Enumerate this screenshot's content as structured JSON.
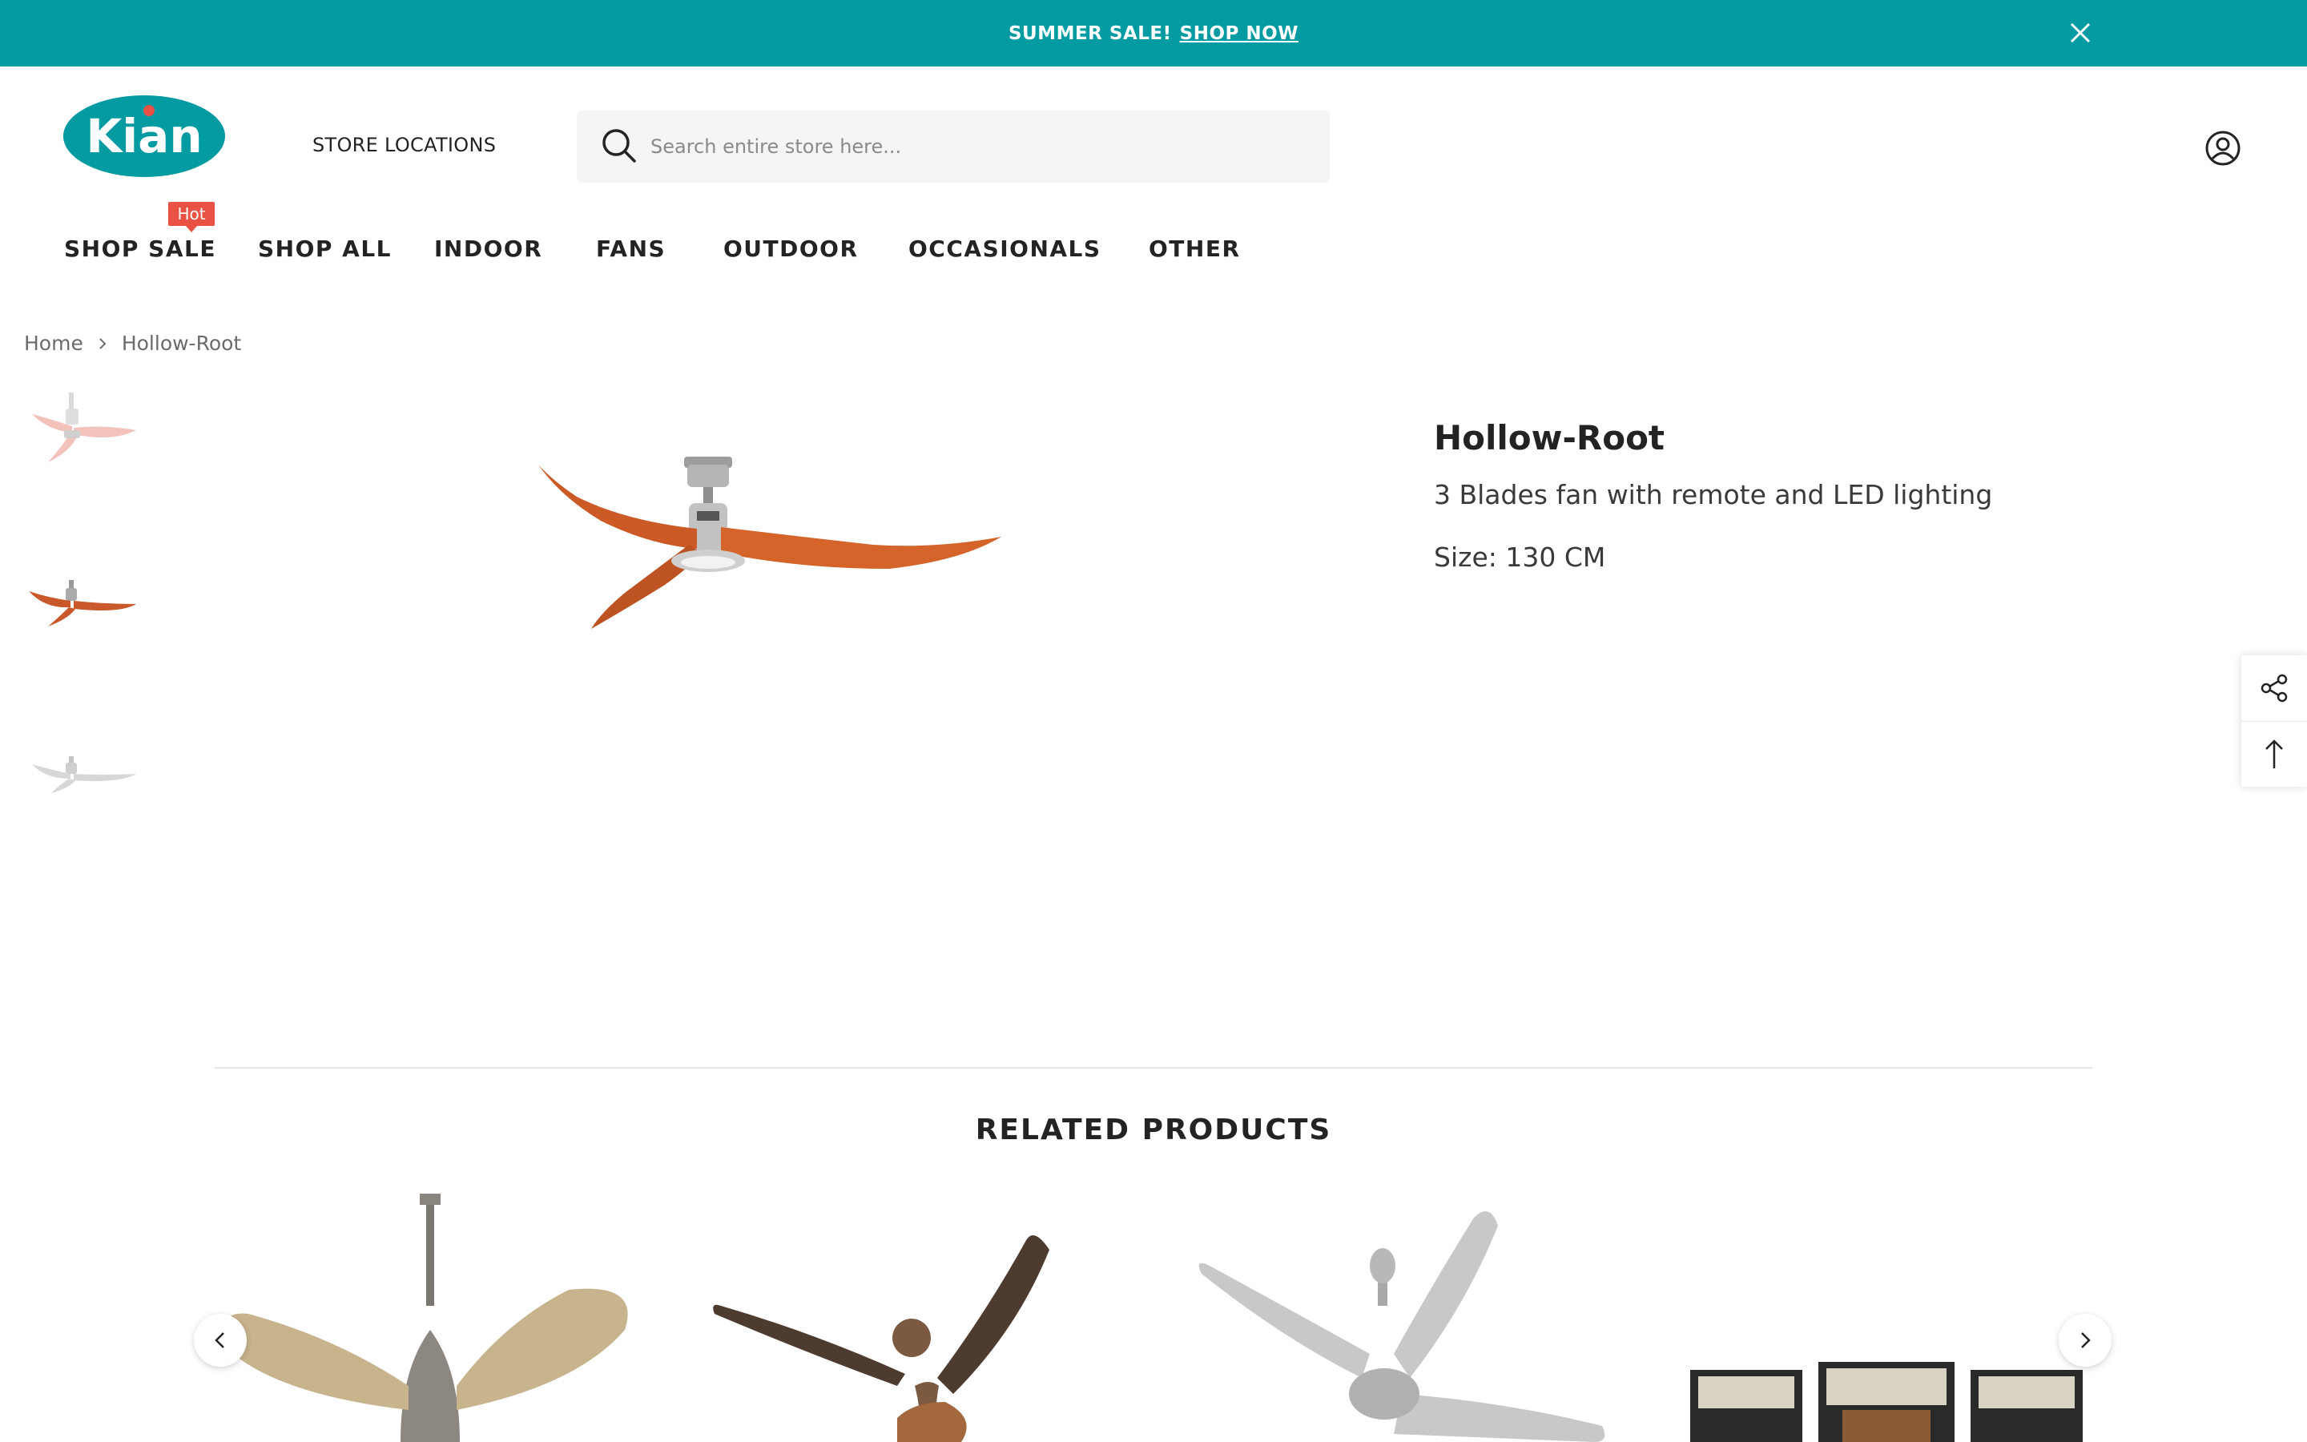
{
  "announcement": {
    "text": "SUMMER SALE!",
    "link_label": "SHOP NOW"
  },
  "header": {
    "logo_text": "Kian",
    "store_locations": "STORE LOCATIONS",
    "search_placeholder": "Search entire store here..."
  },
  "nav": {
    "hot_badge": "Hot",
    "items": [
      {
        "label": "SHOP SALE"
      },
      {
        "label": "SHOP ALL"
      },
      {
        "label": "INDOOR"
      },
      {
        "label": "FANS"
      },
      {
        "label": "OUTDOOR"
      },
      {
        "label": "OCCASIONALS"
      },
      {
        "label": "OTHER"
      }
    ]
  },
  "breadcrumb": {
    "home": "Home",
    "current": "Hollow-Root"
  },
  "product": {
    "title": "Hollow-Root",
    "description": "3 Blades fan with remote and LED lighting",
    "size": "Size: 130 CM",
    "thumbnails": [
      "white-pink fan",
      "orange wood fan",
      "white fan"
    ]
  },
  "related": {
    "title": "RELATED PRODUCTS",
    "items": [
      "rattan blade fan",
      "dark wood fan",
      "silver fan",
      "outdoor sofa set"
    ]
  },
  "colors": {
    "teal": "#019ba1",
    "hot": "#e95144",
    "orange_blade": "#d4642a"
  }
}
